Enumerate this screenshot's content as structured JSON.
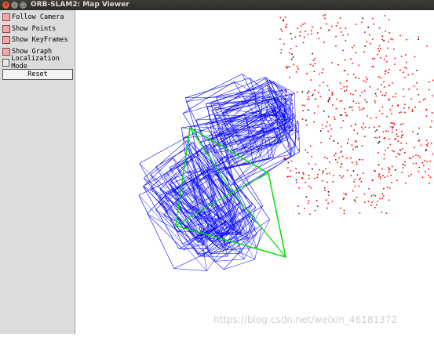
{
  "window": {
    "title": "ORB-SLAM2: Map Viewer",
    "close_glyph": "×",
    "min_glyph": "–",
    "max_glyph": "□"
  },
  "panel": {
    "options": [
      {
        "label": "Follow Camera",
        "checked": true
      },
      {
        "label": "Show Points",
        "checked": true
      },
      {
        "label": "Show KeyFrames",
        "checked": true
      },
      {
        "label": "Show Graph",
        "checked": true
      },
      {
        "label": "Localization Mode",
        "checked": false
      }
    ],
    "reset_label": "Reset"
  },
  "viewer": {
    "keyframe_color": "#0000ff",
    "current_camera_color": "#00e000",
    "map_point_color": "#ff0000",
    "reference_point_color": "#000000"
  },
  "watermark": "https://blog.csdn.net/weixin_46181372"
}
